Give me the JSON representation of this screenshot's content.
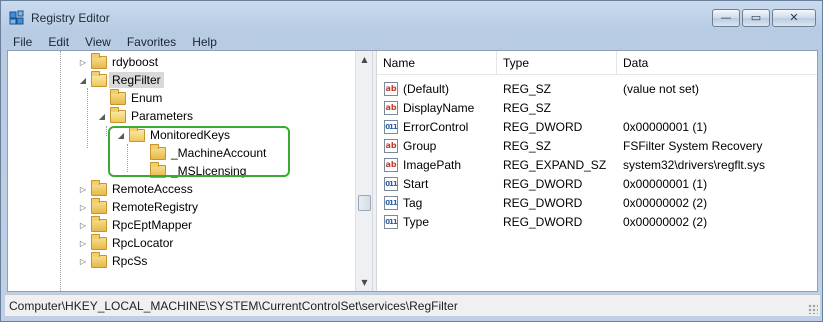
{
  "window": {
    "title": "Registry Editor",
    "minimize_glyph": "—",
    "maximize_glyph": "▭",
    "close_glyph": "✕"
  },
  "menu": [
    "File",
    "Edit",
    "View",
    "Favorites",
    "Help"
  ],
  "tree": [
    {
      "label": "rdyboost",
      "state": "collapsed"
    },
    {
      "label": "RegFilter",
      "state": "expanded",
      "selected": true
    },
    {
      "label": "Enum",
      "state": "leaf"
    },
    {
      "label": "Parameters",
      "state": "expanded"
    },
    {
      "label": "MonitoredKeys",
      "state": "expanded"
    },
    {
      "label": "_MachineAccount",
      "state": "leaf"
    },
    {
      "label": "_MSLicensing",
      "state": "leaf"
    },
    {
      "label": "RemoteAccess",
      "state": "collapsed"
    },
    {
      "label": "RemoteRegistry",
      "state": "collapsed"
    },
    {
      "label": "RpcEptMapper",
      "state": "collapsed"
    },
    {
      "label": "RpcLocator",
      "state": "collapsed"
    },
    {
      "label": "RpcSs",
      "state": "collapsed"
    }
  ],
  "list": {
    "columns": [
      "Name",
      "Type",
      "Data"
    ],
    "rows": [
      {
        "icon": "string-value-icon",
        "name": "(Default)",
        "type": "REG_SZ",
        "data": "(value not set)"
      },
      {
        "icon": "string-value-icon",
        "name": "DisplayName",
        "type": "REG_SZ",
        "data": ""
      },
      {
        "icon": "binary-value-icon",
        "name": "ErrorControl",
        "type": "REG_DWORD",
        "data": "0x00000001 (1)"
      },
      {
        "icon": "string-value-icon",
        "name": "Group",
        "type": "REG_SZ",
        "data": "FSFilter System Recovery"
      },
      {
        "icon": "string-value-icon",
        "name": "ImagePath",
        "type": "REG_EXPAND_SZ",
        "data": "system32\\drivers\\regflt.sys"
      },
      {
        "icon": "binary-value-icon",
        "name": "Start",
        "type": "REG_DWORD",
        "data": "0x00000001 (1)"
      },
      {
        "icon": "binary-value-icon",
        "name": "Tag",
        "type": "REG_DWORD",
        "data": "0x00000002 (2)"
      },
      {
        "icon": "binary-value-icon",
        "name": "Type",
        "type": "REG_DWORD",
        "data": "0x00000002 (2)"
      }
    ]
  },
  "status": {
    "path": "Computer\\HKEY_LOCAL_MACHINE\\SYSTEM\\CurrentControlSet\\services\\RegFilter"
  },
  "colors": {
    "highlight": "#3aaa35",
    "selection": "#d9d9d9"
  }
}
